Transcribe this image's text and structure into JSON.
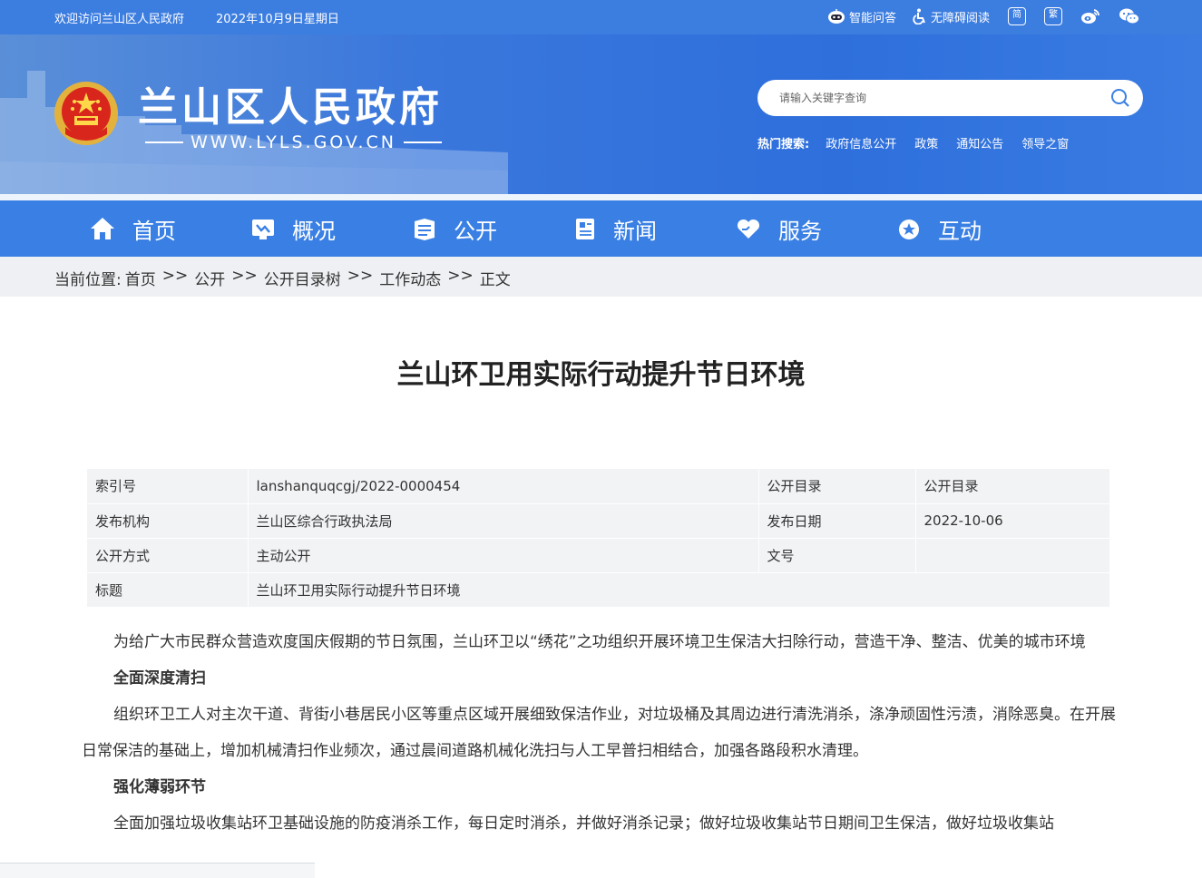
{
  "topbar": {
    "welcome": "欢迎访问兰山区人民政府",
    "date": "2022年10月9日星期日",
    "qa_label": "智能问答",
    "access_label": "无障碍阅读",
    "simplified_label": "简",
    "traditional_label": "繁"
  },
  "header": {
    "title": "兰山区人民政府",
    "url": "WWW.LYLS.GOV.CN",
    "search_placeholder": "请输入关键字查询",
    "hot_label": "热门搜索:",
    "hot_links": [
      "政府信息公开",
      "政策",
      "通知公告",
      "领导之窗"
    ]
  },
  "nav": {
    "items": [
      {
        "label": "首页",
        "icon": "home-icon"
      },
      {
        "label": "概况",
        "icon": "overview-icon"
      },
      {
        "label": "公开",
        "icon": "open-icon"
      },
      {
        "label": "新闻",
        "icon": "news-icon"
      },
      {
        "label": "服务",
        "icon": "service-icon"
      },
      {
        "label": "互动",
        "icon": "interact-icon"
      }
    ]
  },
  "breadcrumb": {
    "prefix": "当前位置:",
    "items": [
      "首页",
      "公开",
      "公开目录树",
      "工作动态",
      "正文"
    ],
    "separator": ">>"
  },
  "article": {
    "title": "兰山环卫用实际行动提升节日环境",
    "meta": {
      "index_label": "索引号",
      "index_value": "lanshanquqcgj/2022-0000454",
      "catalog_label": "公开目录",
      "catalog_value": "公开目录",
      "publisher_label": "发布机构",
      "publisher_value": "兰山区综合行政执法局",
      "pubdate_label": "发布日期",
      "pubdate_value": "2022-10-06",
      "method_label": "公开方式",
      "method_value": "主动公开",
      "docno_label": "文号",
      "docno_value": "",
      "subject_label": "标题",
      "subject_value": "兰山环卫用实际行动提升节日环境"
    },
    "paragraphs": [
      "为给广大市民群众营造欢度国庆假期的节日氛围，兰山环卫以“绣花”之功组织开展环境卫生保洁大扫除行动，营造干净、整洁、优美的城市环境",
      "全面深度清扫",
      "组织环卫工人对主次干道、背街小巷居民小区等重点区域开展细致保洁作业，对垃圾桶及其周边进行清洗消杀，涤净顽固性污渍，消除恶臭。在开展日常保洁的基础上，增加机械清扫作业频次，通过晨间道路机械化洗扫与人工早普扫相结合，加强各路段积水清理。",
      "强化薄弱环节",
      "全面加强垃圾收集站环卫基础设施的防疫消杀工作，每日定时消杀，并做好消杀记录；做好垃圾收集站节日期间卫生保洁，做好垃圾收集站"
    ]
  },
  "colors": {
    "topbar": "#3c7de0",
    "nav": "#3a80e4",
    "breadcrumb_bg": "#eef0f3",
    "meta_bg": "#f2f3f5"
  }
}
